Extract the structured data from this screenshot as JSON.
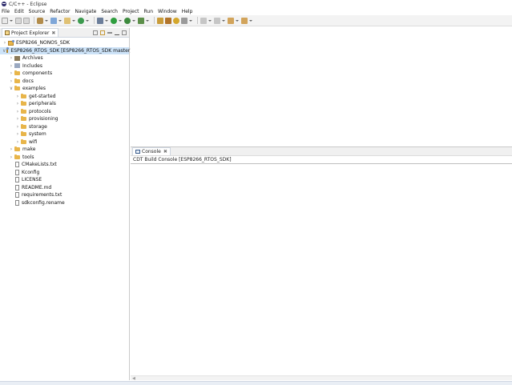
{
  "window": {
    "title": "C/C++ - Eclipse"
  },
  "menu": [
    "File",
    "Edit",
    "Source",
    "Refactor",
    "Navigate",
    "Search",
    "Project",
    "Run",
    "Window",
    "Help"
  ],
  "explorer": {
    "tab_label": "Project Explorer",
    "tab_close": "✖",
    "items": [
      {
        "label": "ESP8266_NONOS_SDK",
        "depth": 0,
        "twist": ">",
        "icon": "project-icon",
        "selected": false
      },
      {
        "label": "ESP8266_RTOS_SDK  [ESP8266_RTOS_SDK master]",
        "depth": 0,
        "twist": "v",
        "icon": "project-icon",
        "selected": true
      },
      {
        "label": "Archives",
        "depth": 1,
        "twist": ">",
        "icon": "archives-icon",
        "selected": false
      },
      {
        "label": "Includes",
        "depth": 1,
        "twist": ">",
        "icon": "includes-icon",
        "selected": false
      },
      {
        "label": "components",
        "depth": 1,
        "twist": ">",
        "icon": "folder-icon",
        "selected": false
      },
      {
        "label": "docs",
        "depth": 1,
        "twist": ">",
        "icon": "folder-icon",
        "selected": false
      },
      {
        "label": "examples",
        "depth": 1,
        "twist": "v",
        "icon": "folder-icon",
        "selected": false
      },
      {
        "label": "get-started",
        "depth": 2,
        "twist": ">",
        "icon": "folder-icon",
        "selected": false
      },
      {
        "label": "peripherals",
        "depth": 2,
        "twist": ">",
        "icon": "folder-icon",
        "selected": false
      },
      {
        "label": "protocols",
        "depth": 2,
        "twist": ">",
        "icon": "folder-icon",
        "selected": false
      },
      {
        "label": "provisioning",
        "depth": 2,
        "twist": ">",
        "icon": "folder-icon",
        "selected": false
      },
      {
        "label": "storage",
        "depth": 2,
        "twist": ">",
        "icon": "folder-icon",
        "selected": false
      },
      {
        "label": "system",
        "depth": 2,
        "twist": ">",
        "icon": "folder-icon",
        "selected": false
      },
      {
        "label": "wifi",
        "depth": 2,
        "twist": ">",
        "icon": "folder-icon",
        "selected": false
      },
      {
        "label": "make",
        "depth": 1,
        "twist": ">",
        "icon": "folder-icon",
        "selected": false
      },
      {
        "label": "tools",
        "depth": 1,
        "twist": ">",
        "icon": "folder-icon",
        "selected": false
      },
      {
        "label": "CMakeLists.txt",
        "depth": 1,
        "twist": "",
        "icon": "file-icon",
        "selected": false
      },
      {
        "label": "Kconfig",
        "depth": 1,
        "twist": "",
        "icon": "file-icon",
        "selected": false
      },
      {
        "label": "LICENSE",
        "depth": 1,
        "twist": "",
        "icon": "file-icon",
        "selected": false
      },
      {
        "label": "README.md",
        "depth": 1,
        "twist": "",
        "icon": "file-icon",
        "selected": false
      },
      {
        "label": "requirements.txt",
        "depth": 1,
        "twist": "",
        "icon": "file-icon",
        "selected": false
      },
      {
        "label": "sdkconfig.rename",
        "depth": 1,
        "twist": "",
        "icon": "file-icon",
        "selected": false
      }
    ]
  },
  "console": {
    "tab_label": "Console",
    "tab_close": "✖",
    "title": "CDT Build Console [ESP8266_RTOS_SDK]"
  },
  "colors": {
    "selection": "#cde3f8",
    "folder": "#e8b54a",
    "toolbar_bg": "#f3f3f3"
  }
}
